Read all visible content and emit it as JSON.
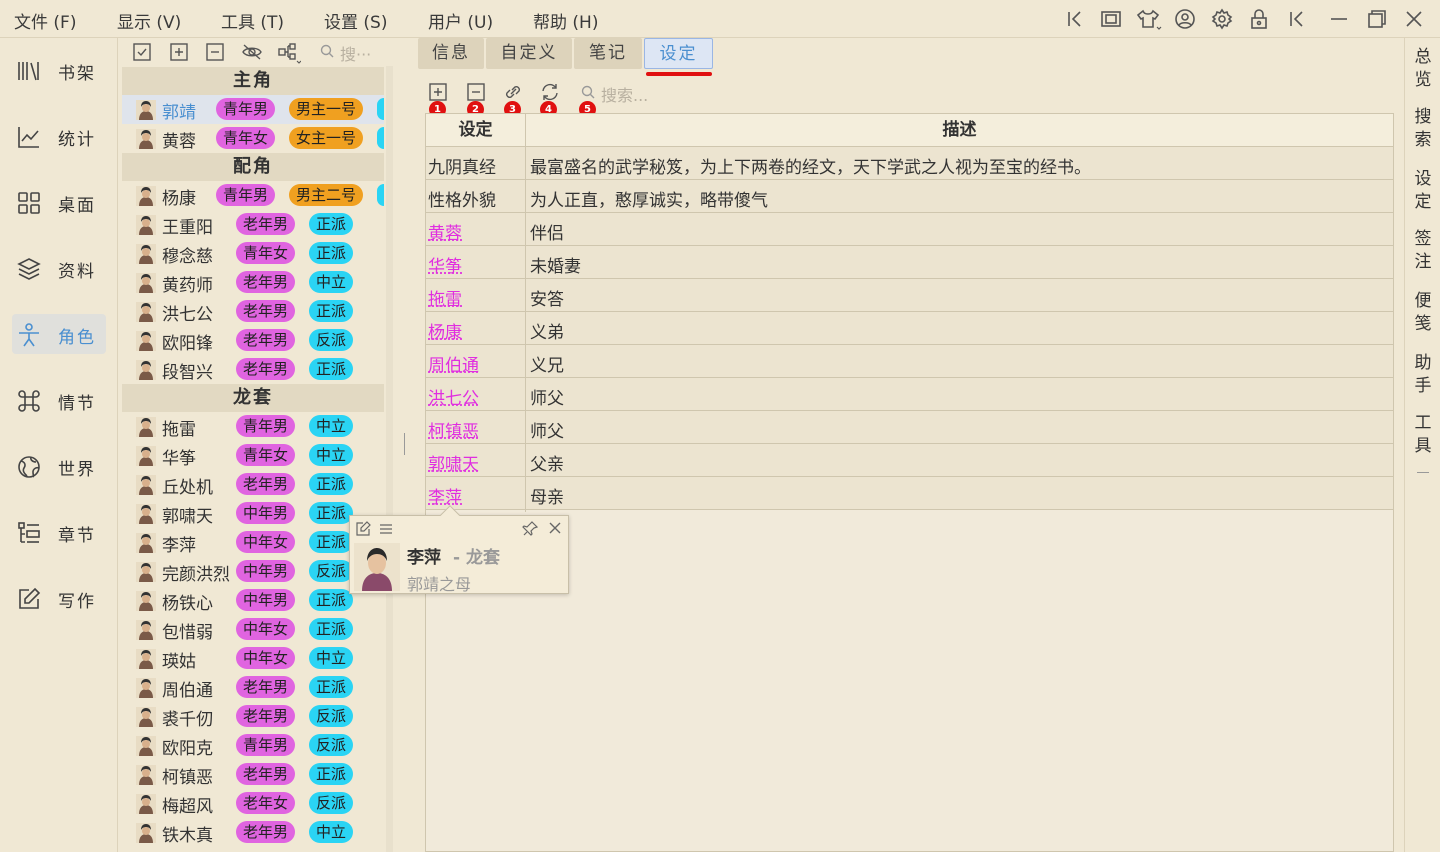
{
  "menu": [
    "文件 (F)",
    "显示 (V)",
    "工具 (T)",
    "设置 (S)",
    "用户 (U)",
    "帮助 (H)"
  ],
  "toolbar_icons": [
    "collapse-left-icon",
    "panel-icon",
    "shirt-icon",
    "user-circle-icon",
    "gear-icon",
    "lock-icon",
    "collapse-left-icon",
    "minimize-icon",
    "restore-icon",
    "close-icon"
  ],
  "nav": [
    {
      "label": "书架",
      "icon": "bookshelf-icon"
    },
    {
      "label": "统计",
      "icon": "chart-icon"
    },
    {
      "label": "桌面",
      "icon": "grid-icon"
    },
    {
      "label": "资料",
      "icon": "layers-icon"
    },
    {
      "label": "角色",
      "icon": "person-icon",
      "active": true
    },
    {
      "label": "情节",
      "icon": "command-icon"
    },
    {
      "label": "世界",
      "icon": "globe-icon"
    },
    {
      "label": "章节",
      "icon": "list-icon"
    },
    {
      "label": "写作",
      "icon": "edit-icon"
    }
  ],
  "charpanel": {
    "search_placeholder": "搜···",
    "groups": [
      {
        "name": "主角",
        "rows": [
          {
            "name": "郭靖",
            "tags": [
              [
                "青年男",
                "p"
              ],
              [
                "男主一号",
                "o"
              ],
              [
                "",
                "c"
              ]
            ],
            "selected": true
          },
          {
            "name": "黄蓉",
            "tags": [
              [
                "青年女",
                "p"
              ],
              [
                "女主一号",
                "o"
              ],
              [
                "",
                "c"
              ]
            ]
          }
        ]
      },
      {
        "name": "配角",
        "rows": [
          {
            "name": "杨康",
            "tags": [
              [
                "青年男",
                "p"
              ],
              [
                "男主二号",
                "o"
              ],
              [
                "",
                "c"
              ]
            ]
          },
          {
            "name": "王重阳",
            "tags": [
              [
                "老年男",
                "p"
              ],
              [
                "正派",
                "c"
              ]
            ]
          },
          {
            "name": "穆念慈",
            "tags": [
              [
                "青年女",
                "p"
              ],
              [
                "正派",
                "c"
              ]
            ]
          },
          {
            "name": "黄药师",
            "tags": [
              [
                "老年男",
                "p"
              ],
              [
                "中立",
                "c"
              ]
            ]
          },
          {
            "name": "洪七公",
            "tags": [
              [
                "老年男",
                "p"
              ],
              [
                "正派",
                "c"
              ]
            ]
          },
          {
            "name": "欧阳锋",
            "tags": [
              [
                "老年男",
                "p"
              ],
              [
                "反派",
                "c"
              ]
            ]
          },
          {
            "name": "段智兴",
            "tags": [
              [
                "老年男",
                "p"
              ],
              [
                "正派",
                "c"
              ]
            ]
          }
        ]
      },
      {
        "name": "龙套",
        "rows": [
          {
            "name": "拖雷",
            "tags": [
              [
                "青年男",
                "p"
              ],
              [
                "中立",
                "c"
              ]
            ]
          },
          {
            "name": "华筝",
            "tags": [
              [
                "青年女",
                "p"
              ],
              [
                "中立",
                "c"
              ]
            ]
          },
          {
            "name": "丘处机",
            "tags": [
              [
                "老年男",
                "p"
              ],
              [
                "正派",
                "c"
              ]
            ]
          },
          {
            "name": "郭啸天",
            "tags": [
              [
                "中年男",
                "p"
              ],
              [
                "正派",
                "c"
              ]
            ]
          },
          {
            "name": "李萍",
            "tags": [
              [
                "中年女",
                "p"
              ],
              [
                "正派",
                "c"
              ]
            ]
          },
          {
            "name": "完颜洪烈",
            "tags": [
              [
                "中年男",
                "p"
              ],
              [
                "反派",
                "c"
              ]
            ]
          },
          {
            "name": "杨铁心",
            "tags": [
              [
                "中年男",
                "p"
              ],
              [
                "正派",
                "c"
              ]
            ]
          },
          {
            "name": "包惜弱",
            "tags": [
              [
                "中年女",
                "p"
              ],
              [
                "正派",
                "c"
              ]
            ]
          },
          {
            "name": "瑛姑",
            "tags": [
              [
                "中年女",
                "p"
              ],
              [
                "中立",
                "c"
              ]
            ]
          },
          {
            "name": "周伯通",
            "tags": [
              [
                "老年男",
                "p"
              ],
              [
                "正派",
                "c"
              ]
            ]
          },
          {
            "name": "裘千仞",
            "tags": [
              [
                "老年男",
                "p"
              ],
              [
                "反派",
                "c"
              ]
            ]
          },
          {
            "name": "欧阳克",
            "tags": [
              [
                "青年男",
                "p"
              ],
              [
                "反派",
                "c"
              ]
            ]
          },
          {
            "name": "柯镇恶",
            "tags": [
              [
                "老年男",
                "p"
              ],
              [
                "正派",
                "c"
              ]
            ]
          },
          {
            "name": "梅超风",
            "tags": [
              [
                "老年女",
                "p"
              ],
              [
                "反派",
                "c"
              ]
            ]
          },
          {
            "name": "铁木真",
            "tags": [
              [
                "老年男",
                "p"
              ],
              [
                "中立",
                "c"
              ]
            ]
          }
        ]
      }
    ]
  },
  "tabs": [
    "信息",
    "自定义",
    "笔记",
    "设定"
  ],
  "active_tab": "设定",
  "table_toolbar": {
    "badges": [
      "1",
      "2",
      "3",
      "4",
      "5"
    ],
    "search_placeholder": "搜索..."
  },
  "table": {
    "headers": [
      "设定",
      "描述"
    ],
    "rows": [
      {
        "key": "九阴真经",
        "desc": "最富盛名的武学秘笈，为上下两卷的经文，天下学武之人视为至宝的经书。",
        "link": false
      },
      {
        "key": "性格外貌",
        "desc": "为人正直，憨厚诚实，略带傻气",
        "link": false
      },
      {
        "key": "黄蓉",
        "desc": "伴侣",
        "link": true
      },
      {
        "key": "华筝",
        "desc": "未婚妻",
        "link": true
      },
      {
        "key": "拖雷",
        "desc": "安答",
        "link": true
      },
      {
        "key": "杨康",
        "desc": "义弟",
        "link": true
      },
      {
        "key": "周伯通",
        "desc": "义兄",
        "link": true
      },
      {
        "key": "洪七公",
        "desc": "师父",
        "link": true
      },
      {
        "key": "柯镇恶",
        "desc": "师父",
        "link": true
      },
      {
        "key": "郭啸天",
        "desc": "父亲",
        "link": true
      },
      {
        "key": "李萍",
        "desc": "母亲",
        "link": true
      }
    ]
  },
  "popup": {
    "name": "李萍",
    "group": "- 龙套",
    "desc": "郭靖之母"
  },
  "rightbar": [
    "总览",
    "搜索",
    "设定",
    "签注",
    "便笺",
    "助手",
    "工具"
  ],
  "colors": {
    "accent": "#4a8fd0",
    "tag_pink": "#e064e0",
    "tag_orange": "#f0a020",
    "tag_cyan": "#2ad4f4",
    "link": "#e02ee0",
    "badge": "#e01010"
  }
}
